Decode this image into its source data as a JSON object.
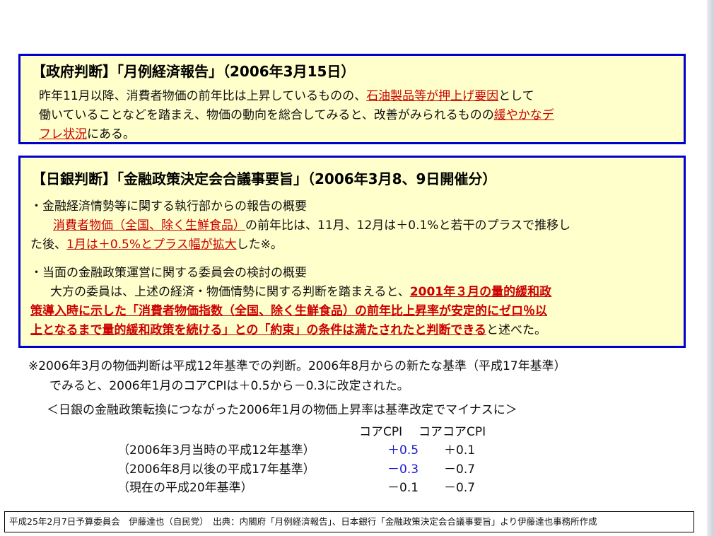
{
  "box1": {
    "title": "【政府判断】「月例経済報告」（2006年3月15日）",
    "l1a": "昨年11月以降、消費者物価の前年比は上昇しているものの、",
    "l1b": "石油製品等が押上げ要因",
    "l1c": "として",
    "l2a": "働いていることなどを踏まえ、物価の動向を総合してみると、改善がみられるものの",
    "l2b": "緩やかなデ",
    "l3a": "フレ状況",
    "l3b": "にある。"
  },
  "box2": {
    "title": "【日銀判断】「金融政策決定会合議事要旨」（2006年3月8、9日開催分）",
    "s1_head": "・金融経済情勢等に関する執行部からの報告の概要",
    "s1_l1a": "消費者物価（全国、除く生鮮食品）",
    "s1_l1b": "の前年比は、11月、12月は＋0.1%と若干のプラスで推移し",
    "s1_l2a": "た後、",
    "s1_l2b": "1月は＋0.5%とプラス幅が拡大",
    "s1_l2c": "した※。",
    "s2_head": "・当面の金融政策運営に関する委員会の検討の概要",
    "s2_l1a": "大方の委員は、上述の経済・物価情勢に関する判断を踏まえると、",
    "s2_l1b": "2001年３月の量的緩和政",
    "s2_l2": "策導入時に示した「消費者物価指数（全国、除く生鮮食品）の前年比上昇率が安定的にゼロ％以",
    "s2_l3a": "上となるまで量的緩和政策を続ける」との「約束」の条件は満たされたと判断できる",
    "s2_l3b": "と述べた。"
  },
  "note": {
    "l1": "※2006年3月の物価判断は平成12年基準での判断。2006年8月からの新たな基準（平成17年基準）",
    "l2": "でみると、2006年1月のコアCPIは＋0.5から－0.3に改定された。",
    "heading": "＜日銀の金融政策転換につながった2006年1月の物価上昇率は基準改定でマイナスに＞"
  },
  "table": {
    "headers": [
      "コアCPI",
      "コアコアCPI"
    ],
    "rows": [
      {
        "label": "（2006年3月当時の平成12年基準）",
        "core": "＋0.5",
        "corecore": "＋0.1"
      },
      {
        "label": "（2006年8月以後の平成17年基準）",
        "core": "－0.3",
        "corecore": "－0.7"
      },
      {
        "label": "（現在の平成20年基準）",
        "core": "－0.1",
        "corecore": "－0.7"
      }
    ]
  },
  "footer": "平成25年2月7日予算委員会　伊藤達也（自民党）　出典：内閣府「月例経済報告」、日本銀行「金融政策決定会合議事要旨」より伊藤達也事務所作成",
  "colors": {
    "accent_red": "#cc0000",
    "border_blue": "#0000cc",
    "box_fill": "#ffffcc",
    "value_blue": "#1a1acc"
  }
}
